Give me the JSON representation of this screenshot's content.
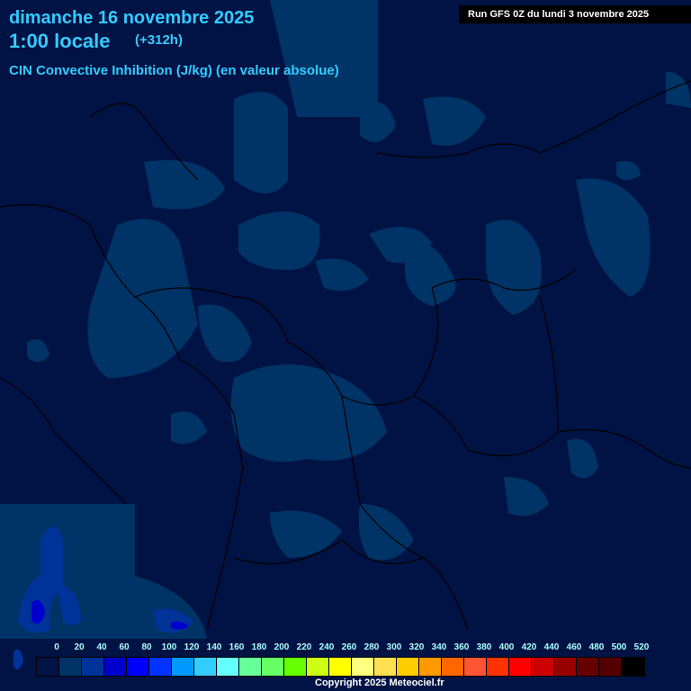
{
  "header": {
    "date": "dimanche 16 novembre 2025",
    "time": "1:00 locale",
    "lead": "(+312h)",
    "variable": "CIN Convective Inhibition (J/kg) (en valeur absolue)",
    "run": "Run GFS 0Z du lundi 3 novembre 2025"
  },
  "legend": {
    "labels": [
      "0",
      "20",
      "40",
      "60",
      "80",
      "100",
      "120",
      "140",
      "160",
      "180",
      "200",
      "220",
      "240",
      "260",
      "280",
      "300",
      "320",
      "340",
      "360",
      "380",
      "400",
      "420",
      "440",
      "460",
      "480",
      "500",
      "520"
    ],
    "colors": [
      "#001344",
      "#003366",
      "#003399",
      "#0000cc",
      "#0000ff",
      "#0033ff",
      "#0099ff",
      "#33ccff",
      "#66ffff",
      "#66ff99",
      "#66ff66",
      "#66ff00",
      "#ccff11",
      "#ffff00",
      "#ffff80",
      "#ffe050",
      "#ffcc00",
      "#ff9900",
      "#ff6600",
      "#ff5533",
      "#ff3300",
      "#ff0000",
      "#cc0000",
      "#990000",
      "#660000",
      "#550000",
      "#000000"
    ]
  },
  "copyright": "Copyright 2025 Meteociel.fr"
}
